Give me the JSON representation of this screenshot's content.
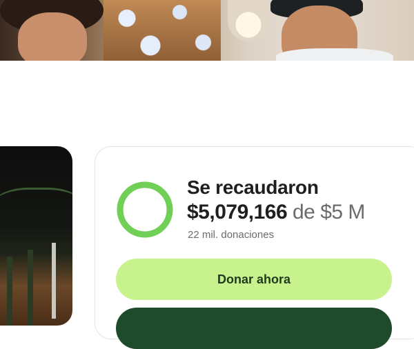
{
  "hero": {
    "image": "hero-photo-two-men-smiling"
  },
  "thumbnail": {
    "image": "campaign-thumbnail-photo"
  },
  "progress": {
    "title": "Se recaudaron",
    "amount": "$5,079,166",
    "goal_text": "de $5 M",
    "donations": "22 mil. donaciones",
    "fraction": 0.99,
    "ring_color": "#6fcf57",
    "ring_track_color": "#bfe9a8"
  },
  "actions": {
    "donate_label": "Donar ahora",
    "donate_color": "#c8f28d",
    "share_color": "#1f4a2c"
  }
}
